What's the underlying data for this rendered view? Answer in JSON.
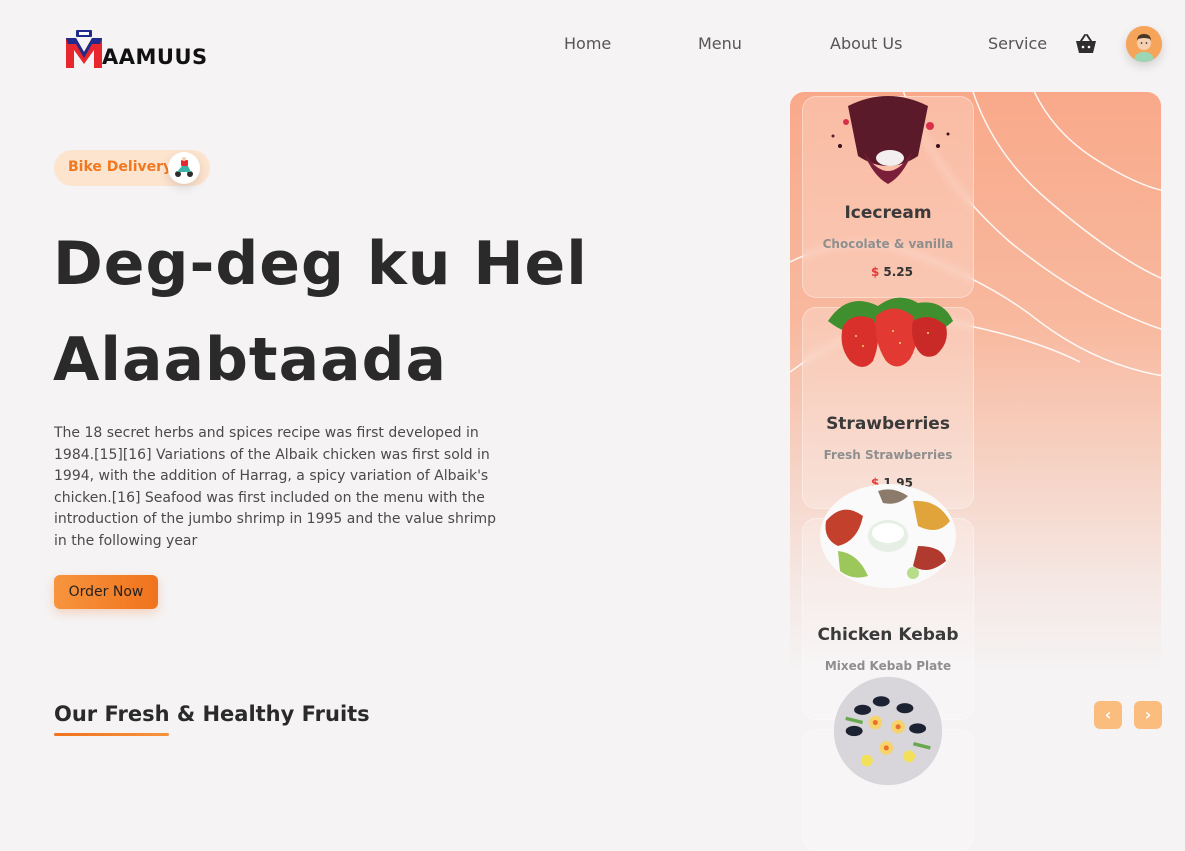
{
  "brand": {
    "logo_text": "AAMUUS"
  },
  "nav": {
    "items": [
      "Home",
      "Menu",
      "About Us",
      "Service"
    ]
  },
  "icons": {
    "cart": "basket-icon",
    "avatar": "user-avatar-icon",
    "delivery": "scooter-icon"
  },
  "hero": {
    "badge": "Bike Delivery",
    "title_line1": "Deg-deg ku Hel",
    "title_line2": "Alaabtaada",
    "body": "The 18 secret herbs and spices recipe was first developed in 1984.[15][16] Variations of the Albaik chicken was first sold in 1994, with the addition of Harrag, a spicy variation of Albaik's chicken.[16] Seafood was first included on the menu with the introduction of the jumbo shrimp in 1995 and the value shrimp in the following year",
    "cta": "Order Now"
  },
  "section": {
    "title": "Our Fresh & Healthy Fruits"
  },
  "cards": [
    {
      "name": "Icecream",
      "desc": "Chocolate & vanilla",
      "currency": "$",
      "price": "5.25"
    },
    {
      "name": "Strawberries",
      "desc": "Fresh Strawberries",
      "currency": "$",
      "price": "1.95"
    },
    {
      "name": "Chicken Kebab",
      "desc": "Mixed Kebab Plate",
      "currency": "$",
      "price": ""
    }
  ],
  "carousel": {
    "prev": "‹",
    "next": "›"
  },
  "colors": {
    "accent": "#f0731d",
    "accent_light": "#fde4cf",
    "panel": "#f9a98a",
    "text": "#2a2a2a"
  }
}
